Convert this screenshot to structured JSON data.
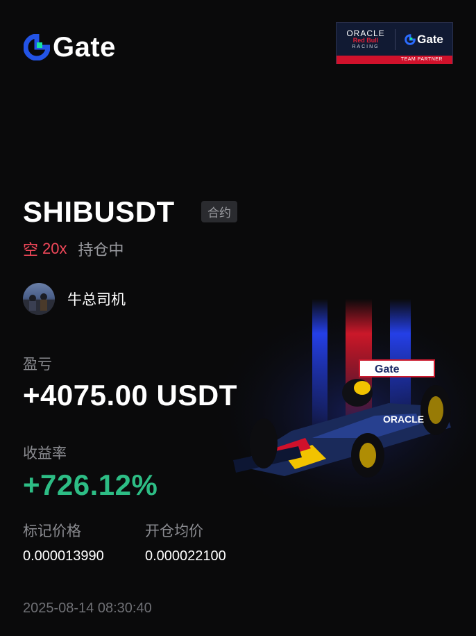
{
  "brand": {
    "name": "Gate",
    "mark_color": "#2354e6",
    "mark_accent": "#17e5a0"
  },
  "partner_badge": {
    "oracle": "ORACLE",
    "redbull": "Red Bull",
    "racing": "RACING",
    "brand": "Gate",
    "caption": "TEAM PARTNER",
    "caption_color": "#d0112b"
  },
  "position": {
    "symbol": "SHIBUSDT",
    "tag": "合约",
    "side": "空",
    "leverage": "20x",
    "status": "持仓中",
    "side_color": "#f2485a"
  },
  "user": {
    "name": "牛总司机",
    "avatar_icon": "avatar-photo"
  },
  "pnl": {
    "label": "盈亏",
    "value": "+4075.00 USDT"
  },
  "roi": {
    "label": "收益率",
    "value": "+726.12%",
    "color": "#2dbd85"
  },
  "prices": {
    "mark_label": "标记价格",
    "mark_value": "0.000013990",
    "entry_label": "开仓均价",
    "entry_value": "0.000022100"
  },
  "timestamp": "2025-08-14 08:30:40"
}
